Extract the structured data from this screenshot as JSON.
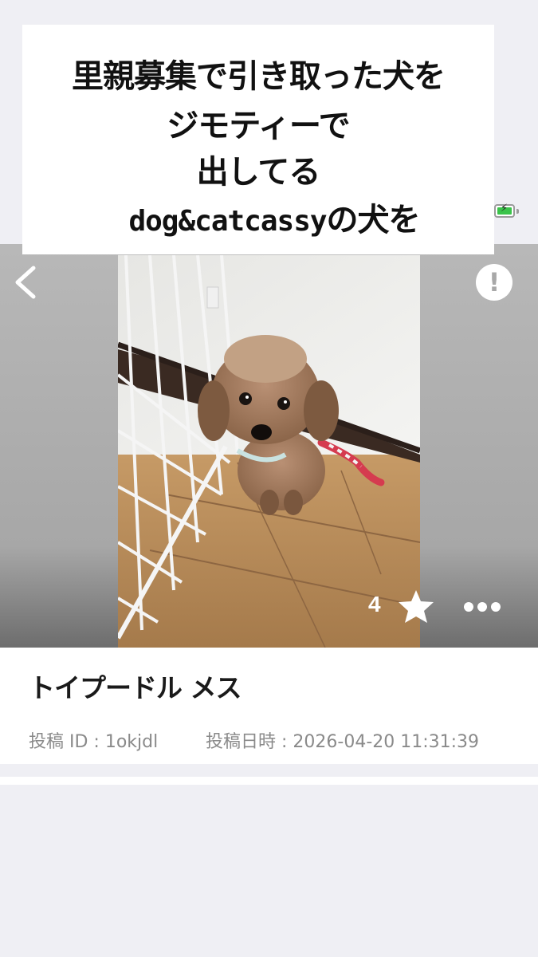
{
  "caption": {
    "line1": "里親募集で引き取った犬を",
    "line2": "ジモティーで",
    "line3": "出してる",
    "line4_latin": "dog&catcassy",
    "line4_jp": "の犬を"
  },
  "status": {
    "battery_icon": "battery-charging-icon",
    "battery_color": "#3ac34a"
  },
  "viewer": {
    "back_icon": "chevron-left-icon",
    "report_icon": "exclamation-icon",
    "report_glyph": "!",
    "favorite_count": "4",
    "favorite_icon": "star-icon",
    "more_icon": "more-dots-icon"
  },
  "listing": {
    "title": "トイプードル メス",
    "post_id": "投稿 ID : 1okjdl",
    "post_date": "投稿日時 : 2026-04-20 11:31:39"
  }
}
